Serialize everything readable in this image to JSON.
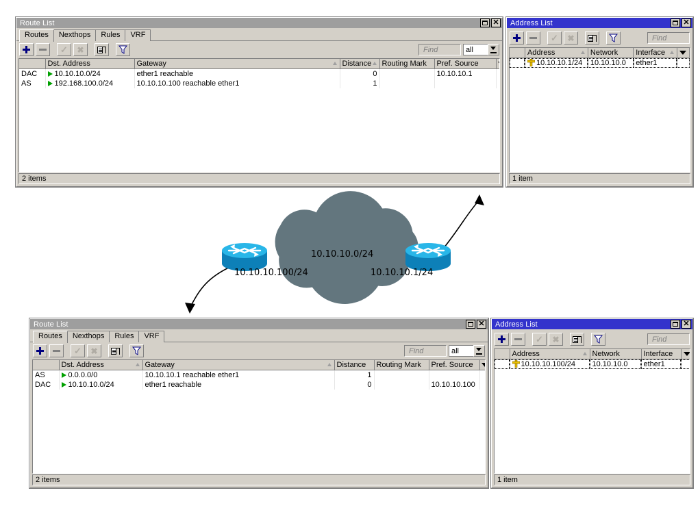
{
  "windows": {
    "route_list_top": {
      "title": "Route List",
      "active": false,
      "tabs": [
        "Routes",
        "Nexthops",
        "Rules",
        "VRF"
      ],
      "active_tab": "Routes",
      "toolbar": {
        "add": "add-button",
        "remove": "remove-button",
        "enable": "enable-button",
        "disable": "disable-button",
        "comment": "comment-button",
        "filter": "filter-button",
        "find_placeholder": "Find",
        "scope_value": "all"
      },
      "columns": [
        "",
        "Dst. Address",
        "Gateway",
        "Distance",
        "Routing Mark",
        "Pref. Source"
      ],
      "sorted_column": "Gateway",
      "rows": [
        {
          "flags": "DAC",
          "dst": "10.10.10.0/24",
          "gateway": "ether1 reachable",
          "distance": "0",
          "routing_mark": "",
          "pref_source": "10.10.10.1"
        },
        {
          "flags": "AS",
          "dst": "192.168.100.0/24",
          "gateway": "10.10.10.100 reachable ether1",
          "distance": "1",
          "routing_mark": "",
          "pref_source": ""
        }
      ],
      "status": "2 items"
    },
    "address_list_top": {
      "title": "Address List",
      "active": true,
      "toolbar": {
        "find_placeholder": "Find"
      },
      "columns": [
        "",
        "Address",
        "Network",
        "Interface"
      ],
      "sorted_column": "Address",
      "rows": [
        {
          "address": "10.10.10.1/24",
          "network": "10.10.10.0",
          "interface": "ether1"
        }
      ],
      "status": "1 item"
    },
    "route_list_bottom": {
      "title": "Route List",
      "active": false,
      "tabs": [
        "Routes",
        "Nexthops",
        "Rules",
        "VRF"
      ],
      "active_tab": "Routes",
      "toolbar": {
        "find_placeholder": "Find",
        "scope_value": "all"
      },
      "columns": [
        "",
        "Dst. Address",
        "Gateway",
        "Distance",
        "Routing Mark",
        "Pref. Source"
      ],
      "sorted_column": "Dst. Address",
      "rows": [
        {
          "flags": "AS",
          "dst": "0.0.0.0/0",
          "gateway": "10.10.10.1 reachable ether1",
          "distance": "1",
          "routing_mark": "",
          "pref_source": ""
        },
        {
          "flags": "DAC",
          "dst": "10.10.10.0/24",
          "gateway": "ether1 reachable",
          "distance": "0",
          "routing_mark": "",
          "pref_source": "10.10.10.100"
        }
      ],
      "status": "2 items"
    },
    "address_list_bottom": {
      "title": "Address List",
      "active": true,
      "toolbar": {
        "find_placeholder": "Find"
      },
      "columns": [
        "",
        "Address",
        "Network",
        "Interface"
      ],
      "sorted_column": "Address",
      "rows": [
        {
          "address": "10.10.10.100/24",
          "network": "10.10.10.0",
          "interface": "ether1"
        }
      ],
      "status": "1 item"
    }
  },
  "diagram": {
    "cloud_label": "10.10.10.0/24",
    "left_router_label": "10.10.10.100/24",
    "right_router_label": "10.10.10.1/24",
    "cloud_color": "#63767e",
    "router_top_color": "#29b6e8",
    "router_body_color": "#0d80b8"
  }
}
